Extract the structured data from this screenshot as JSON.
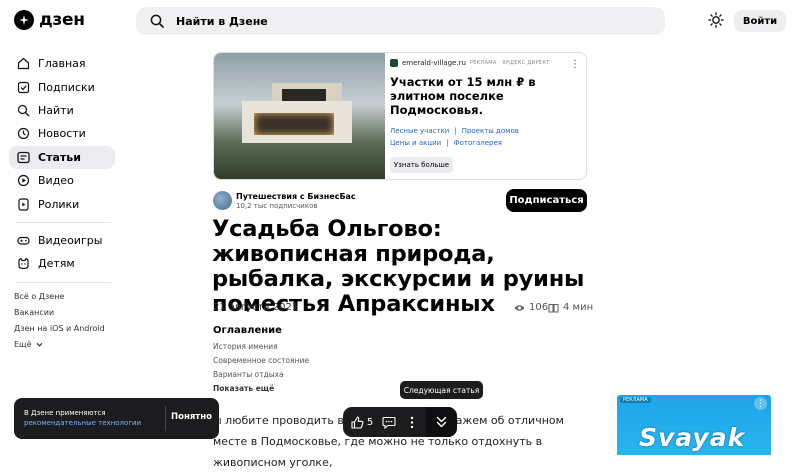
{
  "header": {
    "logo_text": "дзен",
    "search_placeholder": "Найти в Дзене",
    "login_label": "Войти"
  },
  "sidebar": {
    "items": [
      {
        "label": "Главная",
        "icon": "home-icon"
      },
      {
        "label": "Подписки",
        "icon": "subscriptions-icon"
      },
      {
        "label": "Найти",
        "icon": "search-icon"
      },
      {
        "label": "Новости",
        "icon": "news-icon"
      },
      {
        "label": "Статьи",
        "icon": "articles-icon",
        "active": true
      },
      {
        "label": "Видео",
        "icon": "video-icon"
      },
      {
        "label": "Ролики",
        "icon": "shorts-icon"
      }
    ],
    "extra_items": [
      {
        "label": "Видеоигры",
        "icon": "gamepad-icon"
      },
      {
        "label": "Детям",
        "icon": "kids-icon"
      }
    ],
    "footer_links": [
      "Всё о Дзене",
      "Вакансии",
      "Дзен на iOS и Android",
      "Ещё"
    ]
  },
  "ad": {
    "domain": "emerald-village.ru",
    "badge": "РЕКЛАМА · ЯНДЕКС ДИРЕКТ",
    "title": "Участки от 15 млн ₽ в элитном поселке Подмосковья.",
    "links_row1": [
      "Лесные участки",
      "Проекты домов"
    ],
    "links_row2": [
      "Цены и акции",
      "Фотогалерея"
    ],
    "button": "Узнать больше"
  },
  "channel": {
    "name": "Путешествия с БизнесБас",
    "subscribers": "10,2 тыс подписчиков",
    "subscribe_label": "Подписаться"
  },
  "article": {
    "title": "Усадьба Ольгово: живописная природа, рыбалка, экскурсии и руины поместья Апраксиных",
    "date": "21 августа 2021",
    "views": "106",
    "read_time": "4 мин",
    "toc_heading": "Оглавление",
    "toc": [
      "История имения",
      "Современное состояние",
      "Варианты отдыха"
    ],
    "toc_more": "Показать ещё",
    "body_line1_left": "ы любите проводить вых",
    "body_line1_right": "ы расскажем об отличном",
    "body_line2_left": "месте в Подмосковье, где мо",
    "body_line2_mid": "жно не только отдохнуть в живописном уголке,"
  },
  "cookie": {
    "text1": "В Дзене применяются",
    "text2": "рекомендательные технологии",
    "ok": "Понятно"
  },
  "floating_bar": {
    "likes": "5",
    "tooltip": "Следующая статья"
  },
  "right_ad": {
    "badge": "РЕКЛАМА",
    "brand": "Svayak"
  }
}
